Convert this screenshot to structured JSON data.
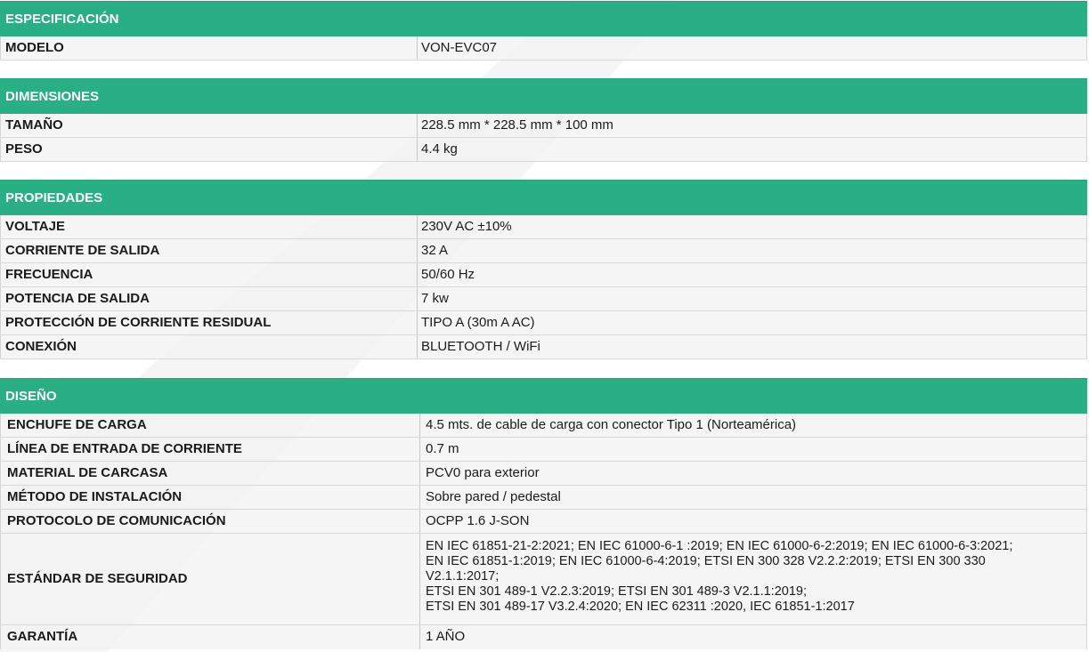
{
  "sections": [
    {
      "title": "ESPECIFICACIÓN",
      "rows": [
        {
          "label": "MODELO",
          "value": "VON-EVC07"
        }
      ]
    },
    {
      "title": "DIMENSIONES",
      "rows": [
        {
          "label": "TAMAÑO",
          "value": "228.5 mm * 228.5 mm * 100 mm"
        },
        {
          "label": "PESO",
          "value": "4.4 kg"
        }
      ]
    },
    {
      "title": "PROPIEDADES",
      "rows": [
        {
          "label": "VOLTAJE",
          "value": "230V AC ±10%"
        },
        {
          "label": "CORRIENTE DE SALIDA",
          "value": "32 A"
        },
        {
          "label": "FRECUENCIA",
          "value": "50/60 Hz"
        },
        {
          "label": "POTENCIA DE SALIDA",
          "value": "7 kw"
        },
        {
          "label": "PROTECCIÓN DE CORRIENTE RESIDUAL",
          "value": "TIPO A (30m A AC)"
        },
        {
          "label": "CONEXIÓN",
          "value": "BLUETOOTH / WiFi"
        }
      ]
    },
    {
      "title": "DISEÑO",
      "rows": [
        {
          "label": "ENCHUFE DE CARGA",
          "value": "4.5 mts. de cable de carga con conector Tipo 1 (Norteamérica)"
        },
        {
          "label": "LÍNEA DE ENTRADA DE CORRIENTE",
          "value": "0.7 m"
        },
        {
          "label": "MATERIAL DE CARCASA",
          "value": "PCV0 para exterior"
        },
        {
          "label": "MÉTODO DE INSTALACIÓN",
          "value": "Sobre pared / pedestal"
        },
        {
          "label": "PROTOCOLO DE COMUNICACIÓN",
          "value": "OCPP 1.6 J-SON"
        },
        {
          "label": "ESTÁNDAR DE SEGURIDAD",
          "value_lines": [
            "EN IEC 61851-21-2:2021; EN IEC 61000-6-1 :2019; EN IEC 61000-6-2:2019; EN IEC 61000-6-3:2021;",
            "EN IEC 61851-1:2019; EN IEC 61000-6-4:2019; ETSI EN 300 328 V2.2.2:2019; ETSI EN 300 330",
            "V2.1.1:2017;",
            "ETSI EN 301 489-1 V2.2.3:2019; ETSI EN 301 489-3 V2.1.1:2019;",
            "ETSI EN 301 489-17 V3.2.4:2020; EN IEC 62311 :2020, IEC 61851-1:2017"
          ]
        },
        {
          "label": "GARANTÍA",
          "value": "1 AÑO"
        }
      ]
    }
  ]
}
